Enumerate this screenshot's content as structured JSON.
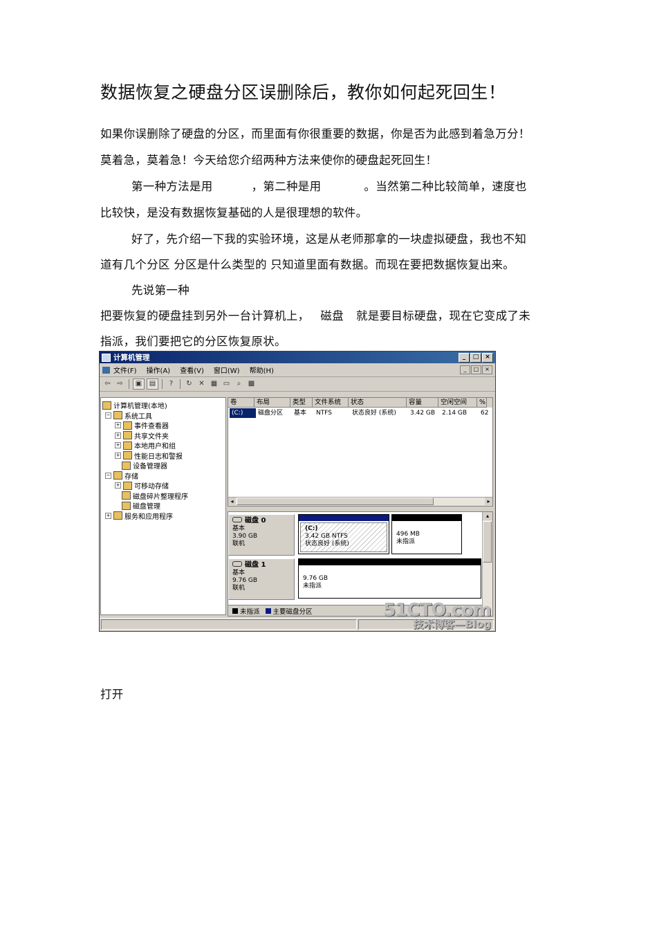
{
  "title": "数据恢复之硬盘分区误删除后，教你如何起死回生！",
  "paragraphs": {
    "p1_line1": "如果你误删除了硬盘的分区，而里面有你很重要的数据，你是否为此感到着急万分！",
    "p1_line2": "莫着急，莫着急！今天给您介绍两种方法来使你的硬盘起死回生！",
    "p2_line1_a": "第一种方法是用",
    "p2_line1_b": "，第二种是用",
    "p2_line1_c": "。当然第二种比较简单，速度也",
    "p2_line2": "比较快，是没有数据恢复基础的人是很理想的软件。",
    "p3_line1": "好了，先介绍一下我的实验环境，这是从老师那拿的一块虚拟硬盘，我也不知",
    "p3_line2": "道有几个分区 分区是什么类型的 只知道里面有数据。而现在要把数据恢复出来。",
    "p4": "先说第一种",
    "p5_line1_a": "把要恢复的硬盘挂到另外一台计算机上，",
    "p5_line1_b": "磁盘",
    "p5_line1_c": "就是要目标硬盘，现在它变成了未",
    "p5_line2": "指派，我们要把它的分区恢复原状。",
    "p6": "打开"
  },
  "window": {
    "title": "计算机管理",
    "controls": [
      "_",
      "□",
      "×"
    ],
    "menu": [
      "文件(F)",
      "操作(A)",
      "查看(V)",
      "窗口(W)",
      "帮助(H)"
    ],
    "tree": [
      {
        "label": "计算机管理(本地)",
        "pm": ""
      },
      {
        "label": "系统工具",
        "pm": "⊟"
      },
      {
        "label": "事件查看器",
        "pm": "⊞"
      },
      {
        "label": "共享文件夹",
        "pm": "⊞"
      },
      {
        "label": "本地用户和组",
        "pm": "⊞"
      },
      {
        "label": "性能日志和警报",
        "pm": "⊞"
      },
      {
        "label": "设备管理器",
        "pm": ""
      },
      {
        "label": "存储",
        "pm": "⊟"
      },
      {
        "label": "可移动存储",
        "pm": "⊞"
      },
      {
        "label": "磁盘碎片整理程序",
        "pm": ""
      },
      {
        "label": "磁盘管理",
        "pm": ""
      },
      {
        "label": "服务和应用程序",
        "pm": "⊞"
      }
    ],
    "columns": [
      "卷",
      "布局",
      "类型",
      "文件系统",
      "状态",
      "容量",
      "空闲空间",
      "%"
    ],
    "rows": [
      [
        "(C:)",
        "磁盘分区",
        "基本",
        "NTFS",
        "状态良好 (系统)",
        "3.42 GB",
        "2.14 GB",
        "62"
      ]
    ],
    "disks": [
      {
        "name": "磁盘 0",
        "type": "基本",
        "size": "3.90 GB",
        "status": "联机",
        "partitions": [
          {
            "label": "(C:)",
            "line1": "3.42 GB NTFS",
            "line2": "状态良好 (系统)",
            "color": "#0a1a80"
          },
          {
            "label": "",
            "line1": "496 MB",
            "line2": "未指派",
            "color": "#000000"
          }
        ]
      },
      {
        "name": "磁盘 1",
        "type": "基本",
        "size": "9.76 GB",
        "status": "联机",
        "partitions": [
          {
            "label": "",
            "line1": "9.76 GB",
            "line2": "未指派",
            "color": "#000000"
          }
        ]
      }
    ],
    "legend": [
      {
        "label": "未指派",
        "color": "#000000"
      },
      {
        "label": "主要磁盘分区",
        "color": "#0a1a80"
      }
    ],
    "watermark": {
      "line1": "51CTO.com",
      "line2": "技术博客—Blog"
    }
  }
}
